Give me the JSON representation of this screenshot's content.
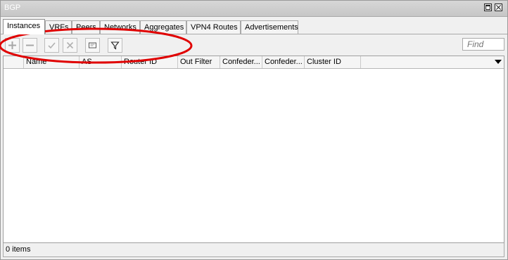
{
  "window": {
    "title": "BGP"
  },
  "tabs": [
    {
      "label": "Instances",
      "active": true
    },
    {
      "label": "VRFs"
    },
    {
      "label": "Peers"
    },
    {
      "label": "Networks"
    },
    {
      "label": "Aggregates"
    },
    {
      "label": "VPN4 Routes"
    },
    {
      "label": "Advertisements"
    }
  ],
  "toolbar": {
    "buttons": [
      "add-icon",
      "remove-icon",
      "enable-icon",
      "disable-icon",
      "comment-icon",
      "filter-icon"
    ]
  },
  "search": {
    "placeholder": "Find"
  },
  "table": {
    "columns": [
      "",
      "Name",
      "AS",
      "Router ID",
      "Out Filter",
      "Confeder...",
      "Confeder...",
      "Cluster ID",
      ""
    ]
  },
  "status": {
    "text": "0 items"
  },
  "colors": {
    "annotation": "#e00000"
  }
}
